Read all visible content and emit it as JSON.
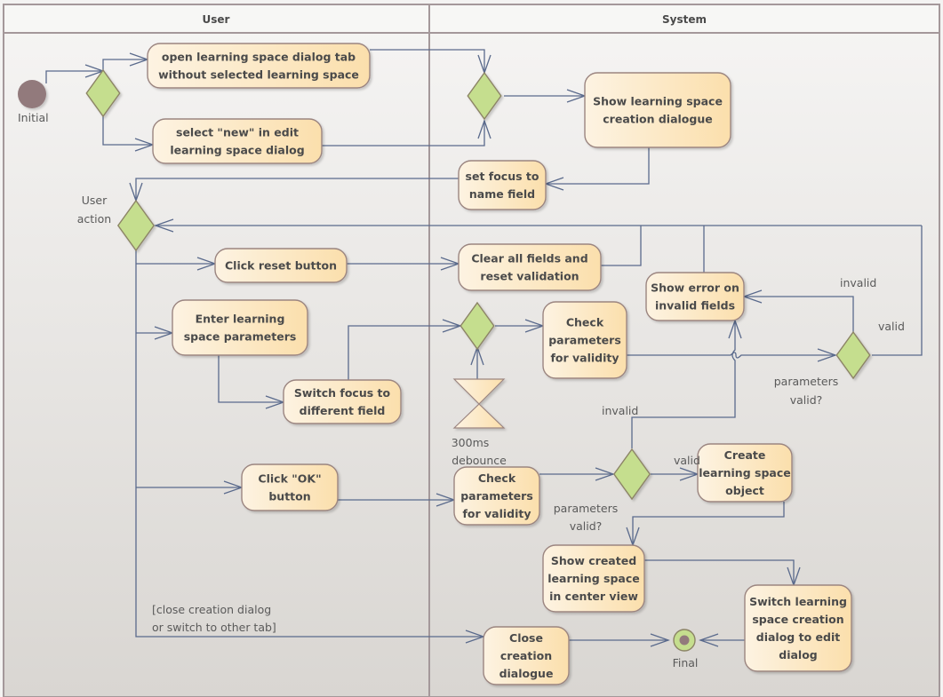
{
  "lanes": [
    {
      "id": "user",
      "title": "User"
    },
    {
      "id": "system",
      "title": "System"
    }
  ],
  "colors": {
    "activity_fill_start": "#fdf3e2",
    "activity_fill_end": "#fbdfac",
    "activity_stroke": "#9b8580",
    "decision_fill": "#c5de8e",
    "decision_stroke": "#8c8466",
    "initial_fill": "#927a7c",
    "edge": "#5a6a8c",
    "lane_border": "#a4989a",
    "header_bg": "#f7f7f5"
  },
  "nodes": {
    "initial": {
      "label": "Initial"
    },
    "final": {
      "label": "Final"
    },
    "open_tab": {
      "lines": [
        "open learning space dialog tab",
        "without selected learning space"
      ]
    },
    "select_new": {
      "lines": [
        "select \"new\" in edit",
        "learning space dialog"
      ]
    },
    "show_dialog": {
      "lines": [
        "Show learning space",
        "creation dialogue"
      ]
    },
    "set_focus": {
      "lines": [
        "set focus to",
        "name field"
      ]
    },
    "user_action": {
      "lines": [
        "User",
        "action"
      ]
    },
    "click_reset": {
      "lines": [
        "Click reset button"
      ]
    },
    "clear_fields": {
      "lines": [
        "Clear all fields and",
        "reset validation"
      ]
    },
    "enter_params": {
      "lines": [
        "Enter learning",
        "space parameters"
      ]
    },
    "switch_focus": {
      "lines": [
        "Switch focus to",
        "different field"
      ]
    },
    "check_params_1": {
      "lines": [
        "Check",
        "parameters",
        "for validity"
      ]
    },
    "show_error": {
      "lines": [
        "Show error on",
        "invalid fields"
      ]
    },
    "debounce": {
      "lines": [
        "300ms",
        "debounce"
      ]
    },
    "params_valid_1": {
      "lines": [
        "parameters",
        "valid?"
      ]
    },
    "click_ok": {
      "lines": [
        "Click \"OK\"",
        "button"
      ]
    },
    "check_params_2": {
      "lines": [
        "Check",
        "parameters",
        "for validity"
      ]
    },
    "params_valid_2": {
      "lines": [
        "parameters",
        "valid?"
      ]
    },
    "create_object": {
      "lines": [
        "Create",
        "learning space",
        "object"
      ]
    },
    "show_created": {
      "lines": [
        "Show created",
        "learning space",
        "in center view"
      ]
    },
    "switch_to_edit": {
      "lines": [
        "Switch learning",
        "space creation",
        "dialog to edit",
        "dialog"
      ]
    },
    "close_dialog": {
      "lines": [
        "Close",
        "creation",
        "dialogue"
      ]
    }
  },
  "edge_labels": {
    "invalid_top": "invalid",
    "valid_right": "valid",
    "invalid_mid": "invalid",
    "valid_mid": "valid",
    "guard_close": [
      "[close creation dialog",
      "or switch to other tab]"
    ]
  }
}
